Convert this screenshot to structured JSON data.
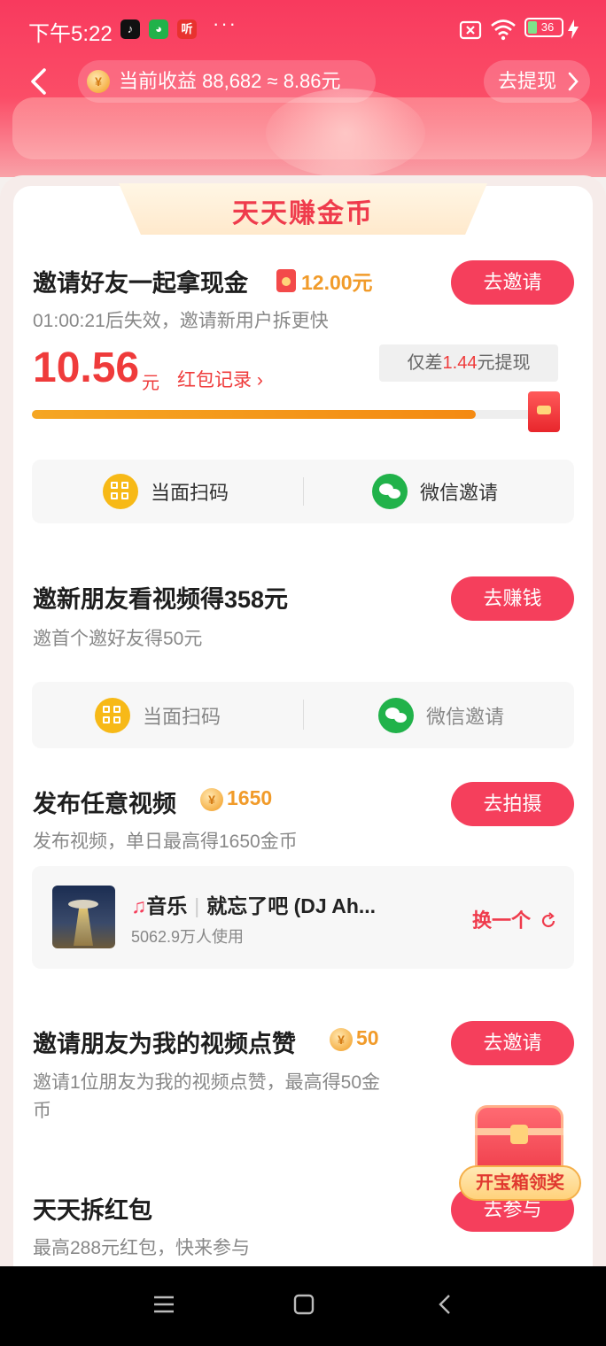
{
  "status_bar": {
    "time": "下午5:22",
    "more": "···",
    "battery": "36"
  },
  "nav": {
    "earnings_label": "当前收益 88,682 ≈ 8.86元",
    "withdraw_label": "去提现"
  },
  "section_title": "天天赚金币",
  "invite_cash": {
    "title": "邀请好友一起拿现金",
    "reward": "12.00元",
    "subtitle": "01:00:21后失效，邀请新用户拆更快",
    "button": "去邀请",
    "amount": "10.56",
    "amount_unit": "元",
    "record_link": "红包记录 ›",
    "gap_prefix": "仅差",
    "gap_value": "1.44",
    "gap_suffix": "元提现",
    "progress": 0.87,
    "share_scan": "当面扫码",
    "share_wechat": "微信邀请"
  },
  "invite_video": {
    "title": "邀新朋友看视频得358元",
    "subtitle": "邀首个邀好友得50元",
    "button": "去赚钱",
    "share_scan": "当面扫码",
    "share_wechat": "微信邀请"
  },
  "publish_video": {
    "title": "发布任意视频",
    "reward": "1650",
    "subtitle": "发布视频，单日最高得1650金币",
    "button": "去拍摄",
    "music_label": "音乐",
    "song": "就忘了吧 (DJ Ah...",
    "usage": "5062.9万人使用",
    "swap": "换一个"
  },
  "invite_like": {
    "title": "邀请朋友为我的视频点赞",
    "reward": "50",
    "subtitle_line1": "邀请1位朋友为我的视频点赞，最高得50金",
    "subtitle_line2": "币",
    "button": "去邀请"
  },
  "daily_redpack": {
    "title": "天天拆红包",
    "subtitle": "最高288元红包，快来参与",
    "button": "去参与"
  },
  "treasure_chest": {
    "label": "开宝箱领奖"
  },
  "colors": {
    "brand_red": "#f53f5c",
    "reward_orange": "#f19b2a",
    "progress_orange": "#f48a12",
    "wechat_green": "#21b24a",
    "scan_yellow": "#f7b917"
  },
  "icons": {
    "coin": "¥"
  }
}
